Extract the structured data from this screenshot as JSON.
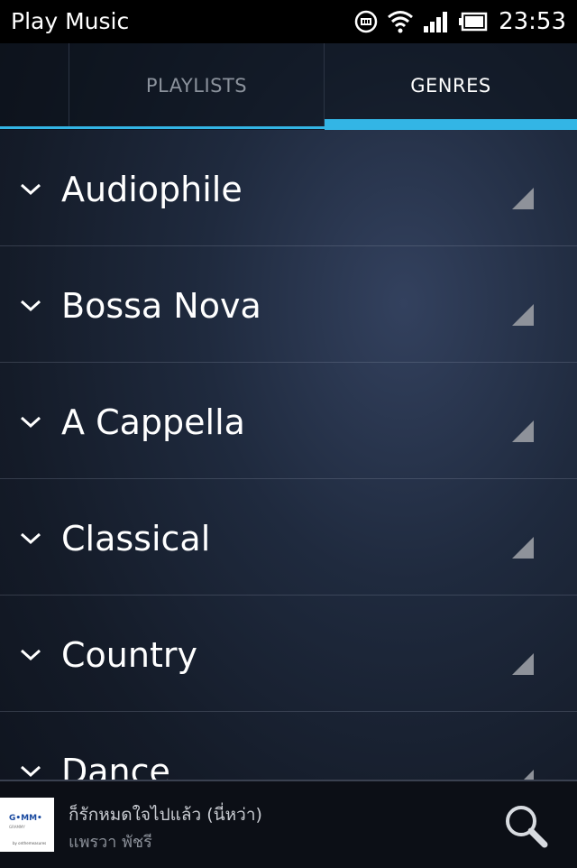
{
  "status_bar": {
    "app_name": "Play Music",
    "time": "23:53",
    "icons": [
      "notification-icon",
      "wifi-icon",
      "signal-icon",
      "battery-icon"
    ]
  },
  "tabs": [
    {
      "label": "PLAYLISTS",
      "selected": false
    },
    {
      "label": "GENRES",
      "selected": true
    }
  ],
  "accent_color": "#33b5e5",
  "genres": [
    {
      "label": "Audiophile"
    },
    {
      "label": "Bossa Nova"
    },
    {
      "label": "A Cappella"
    },
    {
      "label": "Classical"
    },
    {
      "label": "Country"
    },
    {
      "label": "Dance"
    }
  ],
  "now_playing": {
    "album_art_text": "G•MM•",
    "album_art_sub": "GRAMMY",
    "album_art_foot": "by onthemeasures",
    "title": "ก็รักหมดใจไปแล้ว (นี่หว่า)",
    "artist": "แพรวา พัชรี"
  }
}
